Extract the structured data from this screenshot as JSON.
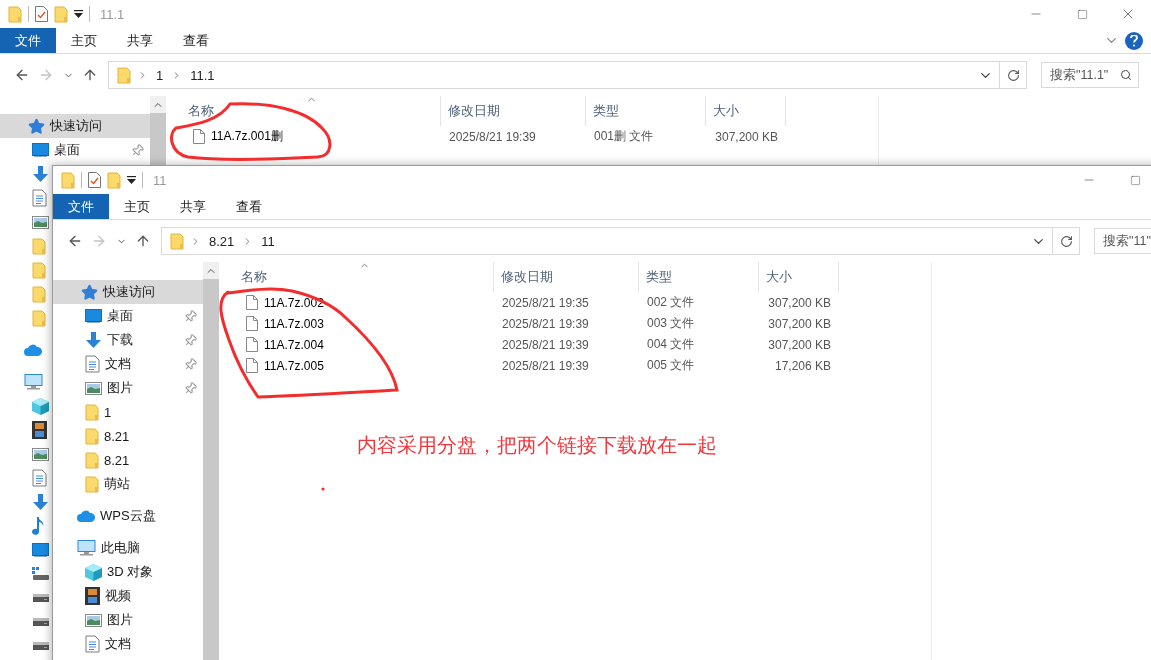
{
  "windows": [
    {
      "title": "11.1",
      "closable": true,
      "ribbon_help": true,
      "ribbon_tabs": [
        {
          "label": "文件",
          "kind": "menu"
        },
        {
          "label": "主页",
          "kind": "tab"
        },
        {
          "label": "共享",
          "kind": "tab"
        },
        {
          "label": "查看",
          "kind": "tab"
        }
      ],
      "breadcrumb": [
        "1",
        "11.1"
      ],
      "search": {
        "placeholder": "搜索\"11.1\""
      },
      "sidebar": [
        {
          "label": "快速访问",
          "kind": "star",
          "selected": true,
          "children": [
            {
              "label": "桌面",
              "kind": "desktop",
              "pinned": true,
              "selected": false
            },
            {
              "kind": "download",
              "selected": false
            },
            {
              "kind": "doc",
              "selected": false
            },
            {
              "kind": "pictures",
              "selected": false
            },
            {
              "kind": "folder",
              "selected": false
            },
            {
              "kind": "folder",
              "selected": false
            },
            {
              "kind": "folder",
              "selected": false
            },
            {
              "kind": "folder",
              "selected": false
            }
          ]
        },
        {
          "kind": "cloud",
          "selected": false
        },
        {
          "kind": "pc",
          "selected": false,
          "children": [
            {
              "kind": "cube",
              "selected": false
            },
            {
              "kind": "video",
              "selected": false
            },
            {
              "kind": "pictures",
              "selected": false
            },
            {
              "kind": "doc",
              "selected": false
            },
            {
              "kind": "download",
              "selected": false
            },
            {
              "kind": "music",
              "selected": false
            },
            {
              "kind": "desktop",
              "selected": false
            },
            {
              "kind": "netdrive",
              "selected": false
            },
            {
              "kind": "drive",
              "selected": false
            },
            {
              "kind": "drive",
              "selected": false
            },
            {
              "kind": "drive",
              "selected": false
            }
          ]
        }
      ],
      "columns": [
        "名称",
        "修改日期",
        "类型",
        "大小"
      ],
      "files": [
        {
          "name": "11A.7z.001删",
          "modified": "2025/8/21 19:39",
          "type": "001删 文件",
          "size": "307,200 KB"
        }
      ]
    },
    {
      "title": "11",
      "ribbon_tabs": [
        {
          "label": "文件",
          "kind": "menu"
        },
        {
          "label": "主页",
          "kind": "tab"
        },
        {
          "label": "共享",
          "kind": "tab"
        },
        {
          "label": "查看",
          "kind": "tab"
        }
      ],
      "breadcrumb": [
        "8.21",
        "11"
      ],
      "search": {
        "placeholder": "搜索\"11\""
      },
      "sidebar": [
        {
          "label": "快速访问",
          "kind": "star",
          "selected": true,
          "children": [
            {
              "label": "桌面",
              "kind": "desktop",
              "pinned": true,
              "selected": false
            },
            {
              "label": "下载",
              "kind": "download",
              "pinned": true,
              "selected": false
            },
            {
              "label": "文档",
              "kind": "doc",
              "pinned": true,
              "selected": false
            },
            {
              "label": "图片",
              "kind": "pictures",
              "pinned": true,
              "selected": false
            },
            {
              "label": "1",
              "kind": "folder",
              "pinned": false,
              "selected": false
            },
            {
              "label": "8.21",
              "kind": "folder",
              "pinned": false,
              "selected": false
            },
            {
              "label": "8.21",
              "kind": "folder",
              "pinned": false,
              "selected": false
            },
            {
              "label": "萌站",
              "kind": "folder",
              "pinned": false,
              "selected": false
            }
          ]
        },
        {
          "label": "WPS云盘",
          "kind": "cloud",
          "selected": false
        },
        {
          "label": "此电脑",
          "kind": "pc",
          "selected": false,
          "children": [
            {
              "label": "3D 对象",
              "kind": "cube",
              "selected": false
            },
            {
              "label": "视频",
              "kind": "video",
              "selected": false
            },
            {
              "label": "图片",
              "kind": "pictures",
              "selected": false
            },
            {
              "label": "文档",
              "kind": "doc",
              "selected": false
            }
          ]
        }
      ],
      "columns": [
        "名称",
        "修改日期",
        "类型",
        "大小"
      ],
      "files": [
        {
          "name": "11A.7z.002",
          "modified": "2025/8/21 19:35",
          "type": "002 文件",
          "size": "307,200 KB"
        },
        {
          "name": "11A.7z.003",
          "modified": "2025/8/21 19:39",
          "type": "003 文件",
          "size": "307,200 KB"
        },
        {
          "name": "11A.7z.004",
          "modified": "2025/8/21 19:39",
          "type": "004 文件",
          "size": "307,200 KB"
        },
        {
          "name": "11A.7z.005",
          "modified": "2025/8/21 19:39",
          "type": "005 文件",
          "size": "17,206 KB"
        }
      ]
    }
  ],
  "annotation": {
    "note": "内容采用分盘，把两个链接下载放在一起"
  }
}
